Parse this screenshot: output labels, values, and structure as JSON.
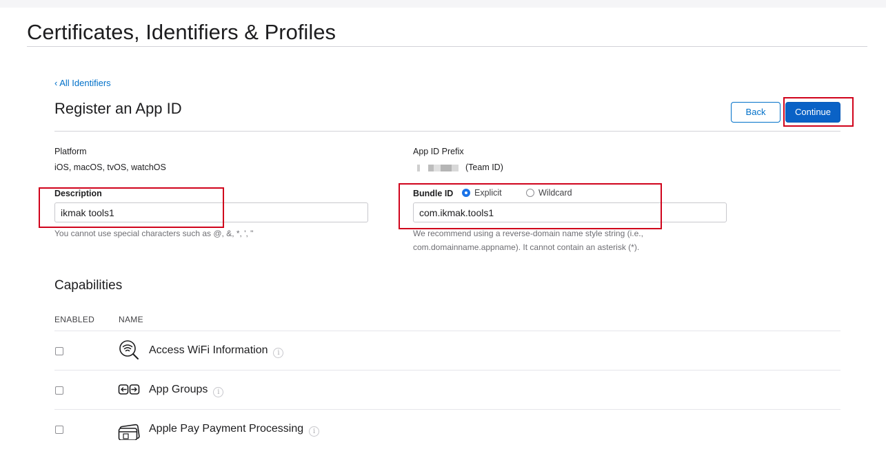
{
  "header": {
    "title": "Certificates, Identifiers & Profiles"
  },
  "nav": {
    "back_link": "‹ All Identifiers"
  },
  "form": {
    "title": "Register an App ID",
    "back_button": "Back",
    "continue_button": "Continue",
    "platform": {
      "label": "Platform",
      "value": "iOS, macOS, tvOS, watchOS"
    },
    "app_id_prefix": {
      "label": "App ID Prefix",
      "value": "(Team ID)"
    },
    "description": {
      "label": "Description",
      "value": "ikmak tools1",
      "hint": "You cannot use special characters such as @, &, *, ', \""
    },
    "bundle_id": {
      "label": "Bundle ID",
      "option_explicit": "Explicit",
      "option_wildcard": "Wildcard",
      "selected": "Explicit",
      "value": "com.ikmak.tools1",
      "hint_line1": "We recommend using a reverse-domain name style string (i.e.,",
      "hint_line2": "com.domainname.appname). It cannot contain an asterisk (*)."
    }
  },
  "capabilities": {
    "title": "Capabilities",
    "col_enabled": "ENABLED",
    "col_name": "NAME",
    "items": [
      {
        "name": "Access WiFi Information",
        "icon": "wifi-search-icon",
        "enabled": false
      },
      {
        "name": "App Groups",
        "icon": "app-groups-icon",
        "enabled": false
      },
      {
        "name": "Apple Pay Payment Processing",
        "icon": "apple-pay-icon",
        "enabled": false
      }
    ]
  },
  "colors": {
    "accent": "#0070c9",
    "primary_button": "#0a62c6",
    "highlight": "#d0021b"
  }
}
